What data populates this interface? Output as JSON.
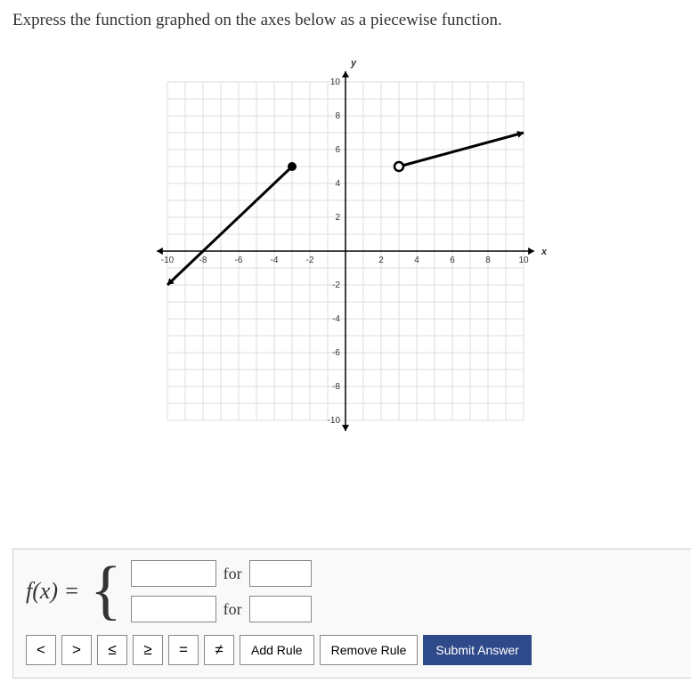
{
  "prompt": "Express the function graphed on the axes below as a piecewise function.",
  "fx_label": "f(x) =",
  "for_label": "for",
  "buttons": {
    "lt": "<",
    "gt": ">",
    "le": "≤",
    "ge": "≥",
    "eq": "=",
    "ne": "≠",
    "add_rule": "Add Rule",
    "remove_rule": "Remove Rule",
    "submit": "Submit Answer"
  },
  "chart_data": {
    "type": "line",
    "title": "",
    "xlabel": "x",
    "ylabel": "y",
    "xlim": [
      -10,
      10
    ],
    "ylim": [
      -10,
      10
    ],
    "x_ticks": [
      -10,
      -8,
      -6,
      -4,
      -2,
      2,
      4,
      6,
      8,
      10
    ],
    "y_ticks": [
      -10,
      -8,
      -6,
      -4,
      -2,
      2,
      4,
      6,
      8,
      10
    ],
    "grid": true,
    "series": [
      {
        "name": "segment1",
        "points": [
          [
            -10,
            -2
          ],
          [
            -3,
            5
          ]
        ],
        "left_endpoint": "arrow",
        "right_endpoint": "closed"
      },
      {
        "name": "segment2",
        "points": [
          [
            3,
            5
          ],
          [
            10,
            7
          ]
        ],
        "left_endpoint": "open",
        "right_endpoint": "arrow"
      }
    ]
  }
}
